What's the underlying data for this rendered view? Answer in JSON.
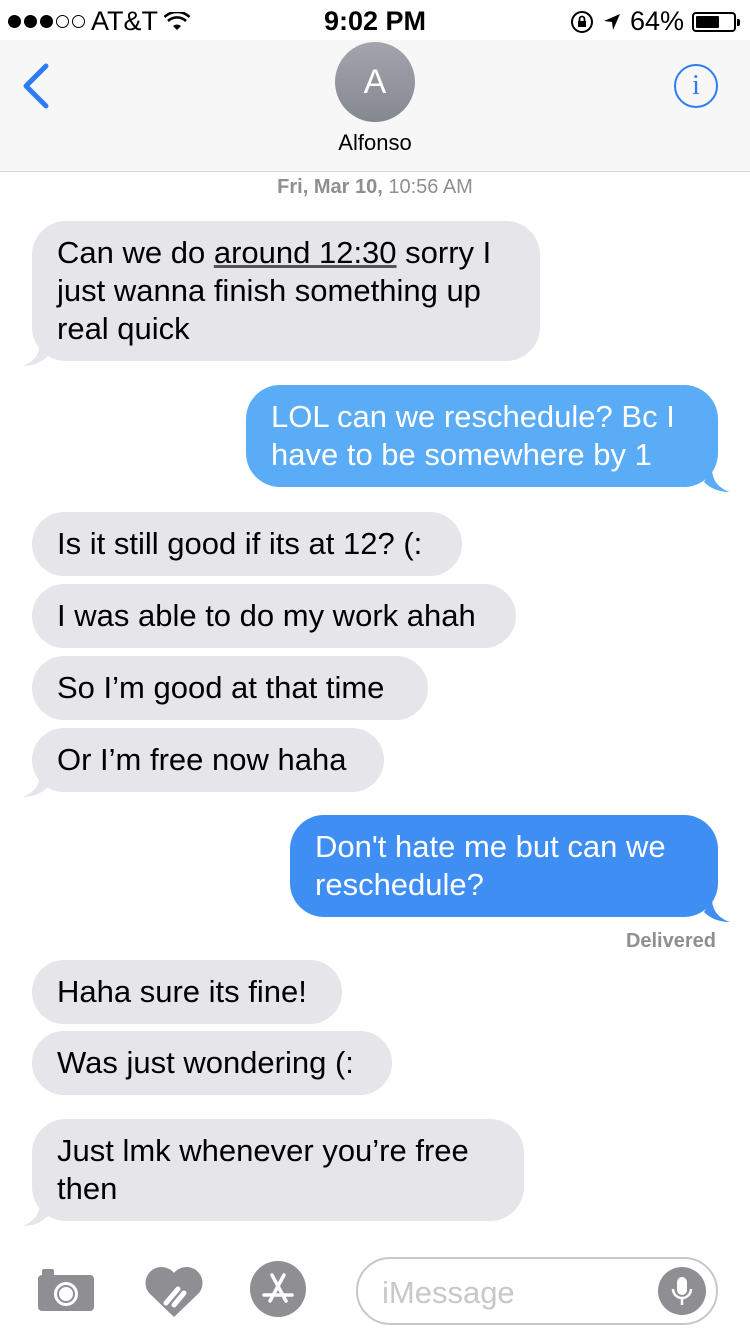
{
  "status_bar": {
    "carrier": "AT&T",
    "time": "9:02 PM",
    "battery_percent_text": "64%",
    "battery_level": 0.64
  },
  "header": {
    "avatar_initial": "A",
    "contact_name": "Alfonso",
    "back_icon": "chevron-left-icon",
    "info_icon": "info-icon"
  },
  "conversation": {
    "timestamp_day": "Fri, Mar 10,",
    "timestamp_time": "10:56 AM",
    "messages": [
      {
        "from": "them",
        "pre": "Can we do ",
        "link": "around 12:30",
        "post": " sorry I just wanna finish something up real quick"
      },
      {
        "from": "me",
        "text": "LOL can we reschedule? Bc I have to be somewhere by 1"
      },
      {
        "from": "them",
        "text": "Is it still good if its at 12? (:"
      },
      {
        "from": "them",
        "text": "I was able to do my work ahah"
      },
      {
        "from": "them",
        "text": "So I’m good at that time"
      },
      {
        "from": "them",
        "text": "Or I’m free now haha"
      },
      {
        "from": "me",
        "text": "Don't hate me but can we reschedule?"
      },
      {
        "from": "them",
        "text": "Haha sure its fine!"
      },
      {
        "from": "them",
        "text": "Was just wondering (:"
      },
      {
        "from": "them",
        "text": "Just lmk whenever you’re free then"
      }
    ],
    "delivered_label": "Delivered"
  },
  "input_bar": {
    "placeholder": "iMessage",
    "icons": [
      "camera-icon",
      "digital-touch-icon",
      "app-store-icon",
      "microphone-icon"
    ]
  },
  "colors": {
    "ios_blue": "#2c7cf6",
    "incoming_bubble": "#e5e5ea",
    "outgoing_bubble_light": "#5aacf6",
    "outgoing_bubble_dark": "#3f8ef4"
  }
}
